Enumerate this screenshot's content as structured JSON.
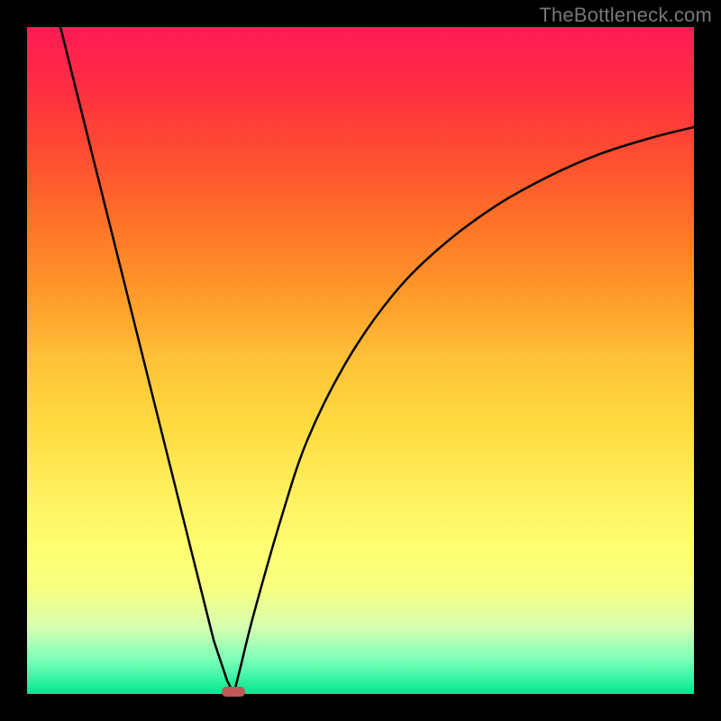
{
  "watermark": "TheBottleneck.com",
  "chart_data": {
    "type": "line",
    "title": "",
    "xlabel": "",
    "ylabel": "",
    "xlim": [
      0,
      100
    ],
    "ylim": [
      0,
      100
    ],
    "grid": false,
    "series": [
      {
        "name": "left-branch",
        "x": [
          5,
          10,
          15,
          20,
          25,
          28,
          30,
          31
        ],
        "values": [
          100,
          80,
          60,
          40,
          20,
          8,
          2,
          0
        ]
      },
      {
        "name": "right-branch",
        "x": [
          31,
          32,
          34,
          38,
          42,
          48,
          55,
          62,
          70,
          78,
          86,
          94,
          100
        ],
        "values": [
          0,
          4,
          12,
          26,
          38,
          50,
          60,
          67,
          73,
          77.5,
          81,
          83.5,
          85
        ]
      }
    ],
    "minimum_marker": {
      "x": 31,
      "y": 0
    },
    "gradient_stops": [
      {
        "pos": 0,
        "color": "#ff1a54"
      },
      {
        "pos": 10,
        "color": "#ff3040"
      },
      {
        "pos": 20,
        "color": "#ff5030"
      },
      {
        "pos": 30,
        "color": "#ff7528"
      },
      {
        "pos": 40,
        "color": "#ff9a2a"
      },
      {
        "pos": 50,
        "color": "#ffc238"
      },
      {
        "pos": 60,
        "color": "#ffdb40"
      },
      {
        "pos": 70,
        "color": "#fff060"
      },
      {
        "pos": 78,
        "color": "#feff70"
      },
      {
        "pos": 84,
        "color": "#f8ff80"
      },
      {
        "pos": 90,
        "color": "#d5ffb0"
      },
      {
        "pos": 95,
        "color": "#78ffb8"
      },
      {
        "pos": 100,
        "color": "#00e890"
      }
    ]
  }
}
